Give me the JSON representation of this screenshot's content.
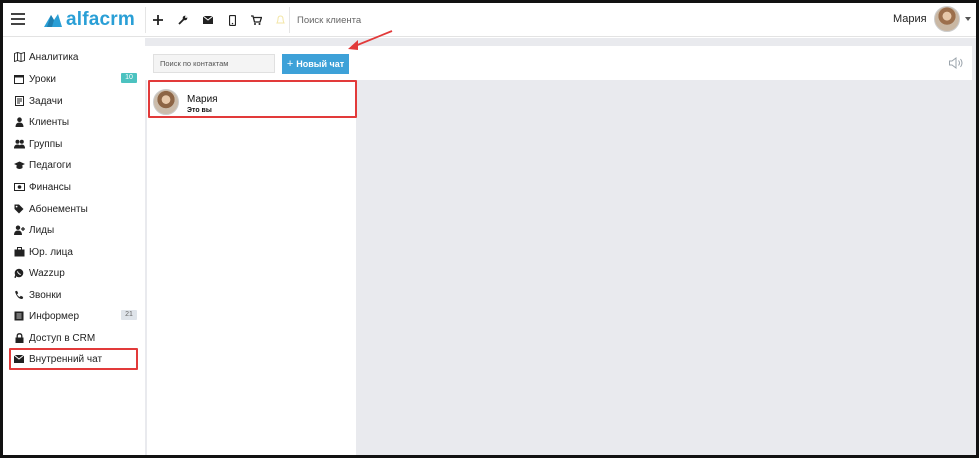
{
  "app": {
    "logo_text": "alfacrm",
    "brand_color": "#2a9fd6"
  },
  "topbar": {
    "icons": [
      "menu-icon",
      "plus-icon",
      "wrench-icon",
      "envelope-icon",
      "mobile-icon",
      "cart-icon",
      "bell-icon"
    ],
    "search_placeholder": "Поиск клиента",
    "user_name": "Мария"
  },
  "sidebar": {
    "items": [
      {
        "label": "Аналитика",
        "icon": "map-icon"
      },
      {
        "label": "Уроки",
        "icon": "calendar-icon",
        "badge": "10"
      },
      {
        "label": "Задачи",
        "icon": "tasks-icon"
      },
      {
        "label": "Клиенты",
        "icon": "user-icon"
      },
      {
        "label": "Группы",
        "icon": "users-icon"
      },
      {
        "label": "Педагоги",
        "icon": "graduation-cap-icon"
      },
      {
        "label": "Финансы",
        "icon": "money-icon"
      },
      {
        "label": "Абонементы",
        "icon": "tag-icon"
      },
      {
        "label": "Лиды",
        "icon": "user-plus-icon"
      },
      {
        "label": "Юр. лица",
        "icon": "briefcase-icon"
      },
      {
        "label": "Wazzup",
        "icon": "whatsapp-icon"
      },
      {
        "label": "Звонки",
        "icon": "phone-icon"
      },
      {
        "label": "Информер",
        "icon": "list-icon",
        "badge": "21"
      },
      {
        "label": "Доступ в CRM",
        "icon": "lock-icon"
      },
      {
        "label": "Внутренний чат",
        "icon": "envelope-icon"
      }
    ],
    "highlight_color": "#e23a3a"
  },
  "chat": {
    "contact_search_placeholder": "Поиск по контактам",
    "new_chat_label": "Новый чат",
    "new_chat_plus": "+",
    "button_color": "#3da1d8",
    "items": [
      {
        "name": "Мария",
        "subtitle": "Это вы"
      }
    ]
  }
}
